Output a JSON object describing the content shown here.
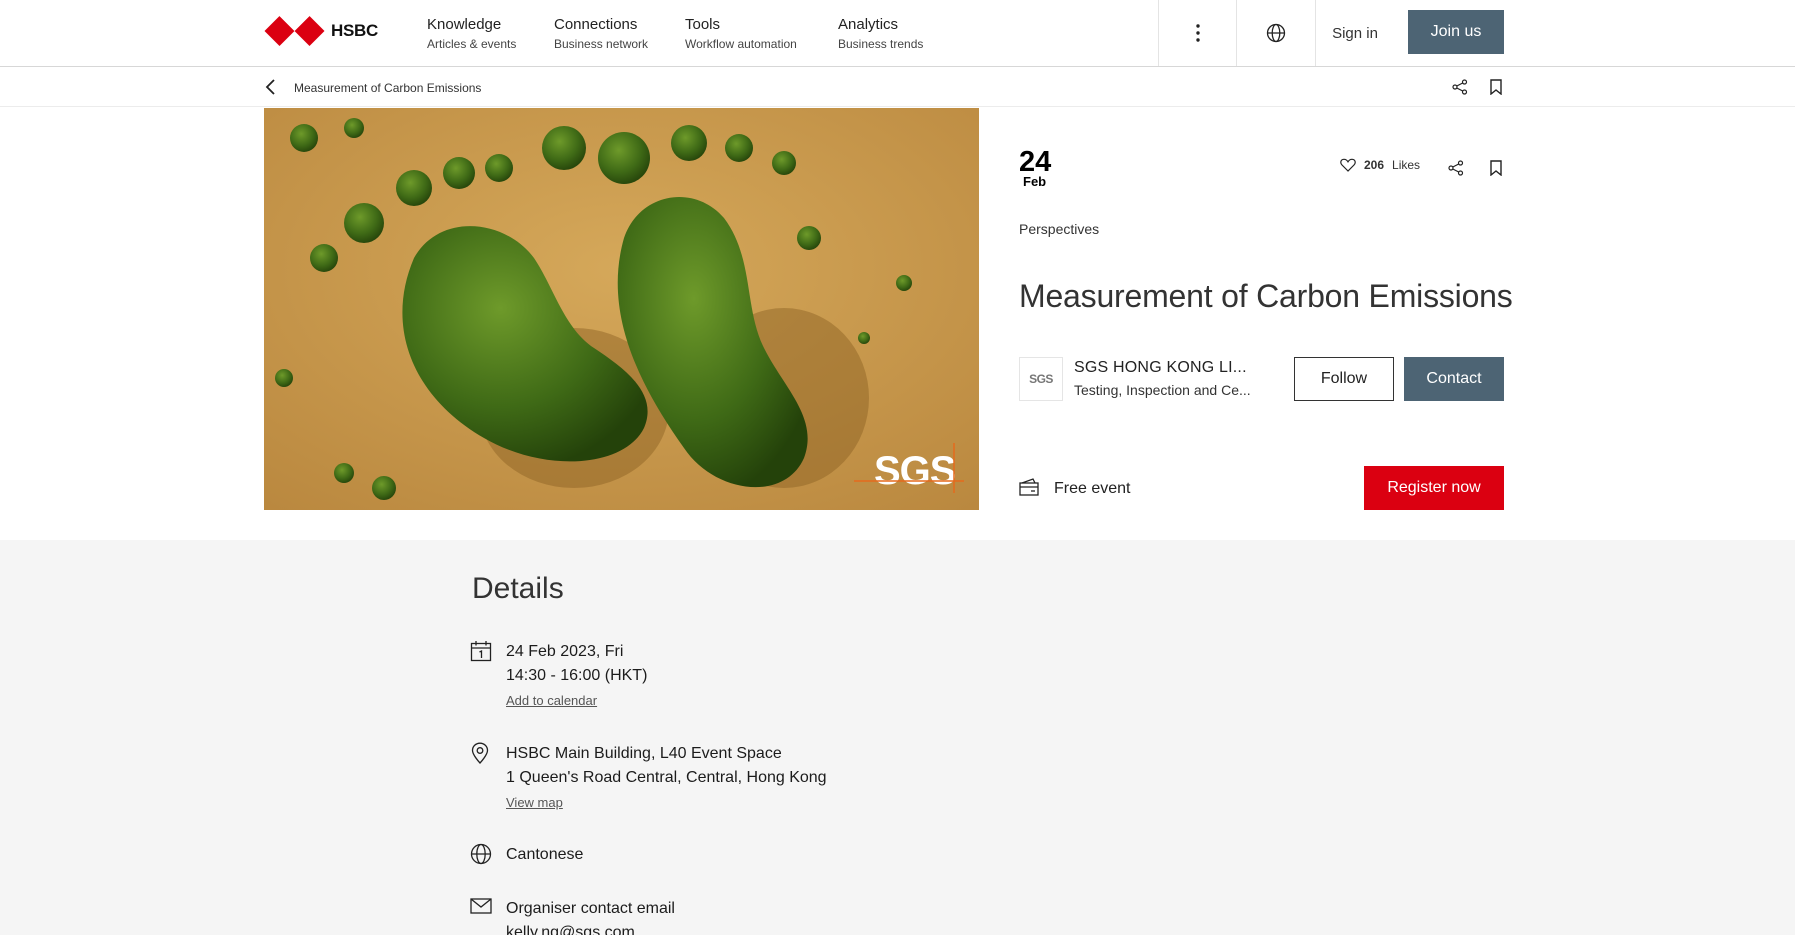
{
  "brand": {
    "name": "HSBC",
    "red": "#db0011"
  },
  "nav": {
    "items": [
      {
        "title": "Knowledge",
        "subtitle": "Articles & events"
      },
      {
        "title": "Connections",
        "subtitle": "Business network"
      },
      {
        "title": "Tools",
        "subtitle": "Workflow automation"
      },
      {
        "title": "Analytics",
        "subtitle": "Business trends"
      }
    ],
    "sign_in": "Sign in",
    "join": "Join us",
    "icons": [
      "more-vertical-icon",
      "globe-icon"
    ]
  },
  "breadcrumb": {
    "label": "Measurement of Carbon Emissions"
  },
  "event": {
    "image_logo": "SGS",
    "day": "24",
    "month": "Feb",
    "likes_count": "206",
    "likes_label": "Likes",
    "category": "Perspectives",
    "title": "Measurement of Carbon Emissions",
    "organiser": {
      "logo": "SGS",
      "name": "SGS HONG KONG LI...",
      "industry": "Testing, Inspection and Ce..."
    },
    "follow_label": "Follow",
    "contact_label": "Contact",
    "price": "Free event",
    "register_label": "Register now"
  },
  "details": {
    "heading": "Details",
    "date": "24 Feb 2023, Fri",
    "time": "14:30 - 16:00 (HKT)",
    "add_calendar": "Add to calendar",
    "venue": "HSBC Main Building, L40 Event Space",
    "address": "1 Queen's Road Central, Central, Hong Kong",
    "view_map": "View map",
    "language": "Cantonese",
    "contact_label": "Organiser contact email",
    "contact_email": "kelly.ng@sgs.com"
  },
  "colors": {
    "accent": "#4d6474",
    "register": "#db0011",
    "details_bg": "#f5f5f5"
  }
}
